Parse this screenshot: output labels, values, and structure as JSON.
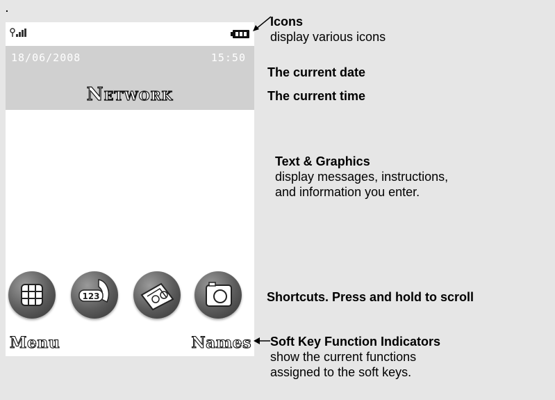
{
  "screen": {
    "date": "18/06/2008",
    "time": "15:50",
    "network": "Network",
    "softkey_left": "Menu",
    "softkey_right": "Names",
    "shortcuts": [
      {
        "icon": "grid-menu-icon"
      },
      {
        "icon": "phone-123-icon"
      },
      {
        "icon": "message-icon"
      },
      {
        "icon": "camera-icon"
      }
    ]
  },
  "annotations": {
    "top_mark": ".",
    "icons_title": "Icons",
    "icons_desc": "display various icons",
    "date_label": "The current date",
    "time_label": "The current time",
    "text_title": "Text & Graphics",
    "text_desc_1": "display messages, instructions,",
    "text_desc_2": "and information you enter.",
    "shortcuts_label": "Shortcuts. Press and hold to scroll",
    "softkeys_title": "Soft Key Function Indicators",
    "softkeys_desc_1": "show the current functions",
    "softkeys_desc_2": "assigned to the soft keys."
  },
  "colors": {
    "page_background": "#e6e6e6",
    "screen_background": "#ffffff",
    "header_band": "#d0d0d0"
  }
}
